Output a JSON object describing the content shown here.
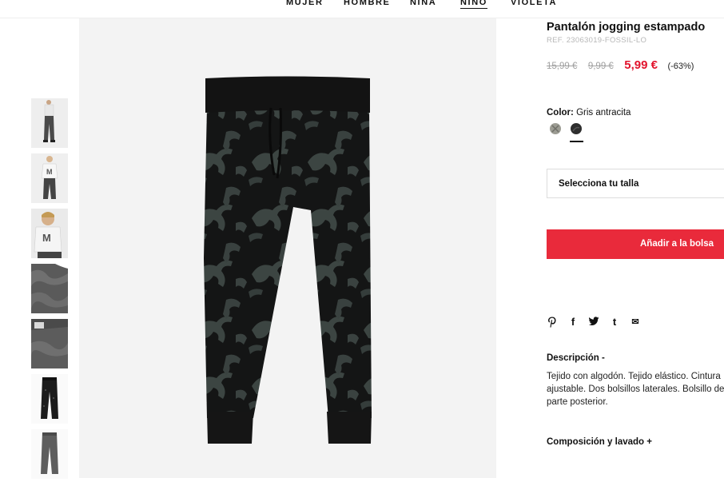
{
  "nav": {
    "items": [
      {
        "label": "MUJER",
        "active": false
      },
      {
        "label": "HOMBRE",
        "active": false
      },
      {
        "label": "NIÑA",
        "active": false
      },
      {
        "label": "NIÑO",
        "active": true
      },
      {
        "label": "VIOLETA",
        "active": false
      }
    ]
  },
  "gallery": {
    "thumbnails": [
      "model-front-pants",
      "model-front-tshirt",
      "model-closeup-tshirt",
      "fabric-detail",
      "waistband-label-detail",
      "pants-black-flat",
      "pants-grey-flat"
    ],
    "main_image": "jogging-pants-dinosaur-print"
  },
  "product": {
    "title": "Pantalón jogging estampado",
    "ref": "REF. 23063019-FOSSIL-LO",
    "price_original": "15,99 €",
    "price_previous": "9,99 €",
    "price_sale": "5,99 €",
    "discount": "(-63%)",
    "color_label": "Color:",
    "color_value": "Gris antracita",
    "size_placeholder": "Selecciona tu talla",
    "add_to_bag": "Añadir a la bolsa",
    "description_title": "Descripción -",
    "description_text": "Tejido con algodón. Tejido elástico. Cintura ajustable. Dos bolsillos laterales. Bolsillo de parte posterior.",
    "composition_title": "Composición y lavado +"
  },
  "swatches": [
    {
      "name": "light-grey-swatch",
      "color": "#9a9a92",
      "selected": false
    },
    {
      "name": "anthracite-swatch",
      "color": "#2e2e2e",
      "selected": true
    }
  ],
  "share": {
    "pinterest": "P",
    "facebook": "f",
    "twitter": "t",
    "tumblr": "t",
    "email": "✉"
  },
  "colors": {
    "sale": "#e2142d",
    "button": "#e92a3b",
    "image_bg": "#f3f3f3"
  }
}
